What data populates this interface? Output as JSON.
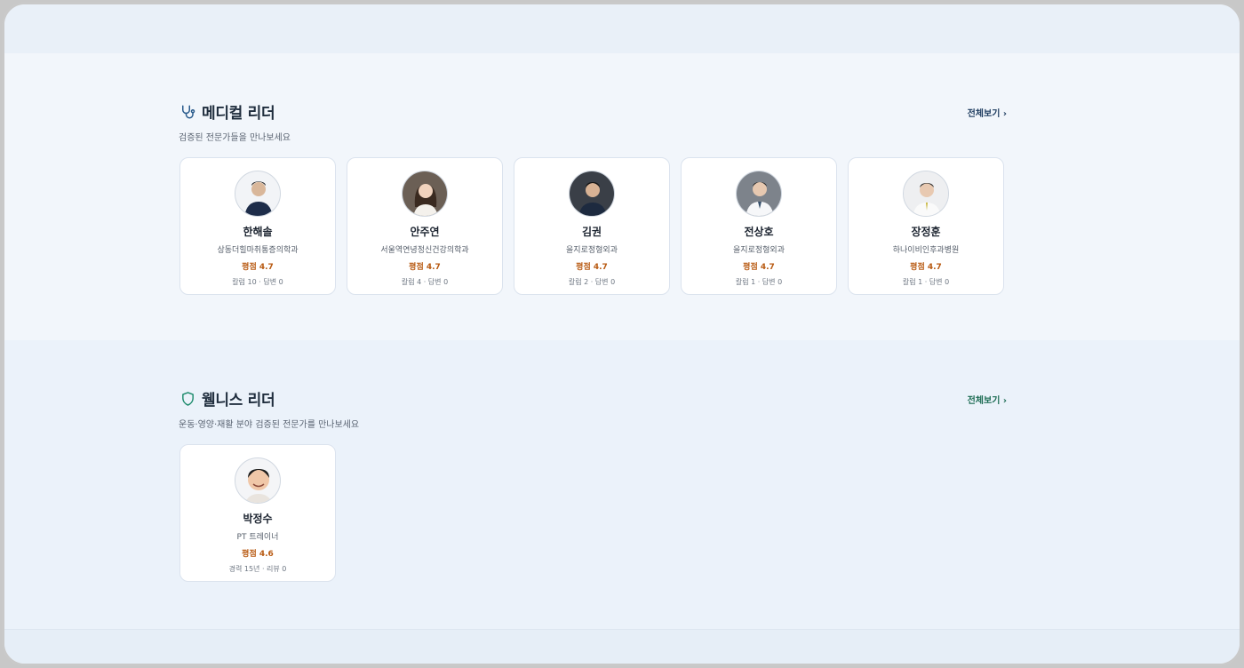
{
  "medical": {
    "title": "메디컬 리더",
    "subtitle": "검증된 전문가들을 만나보세요",
    "view_all": "전체보기 ›",
    "icon": "stethoscope-icon",
    "cards": [
      {
        "name": "한해솔",
        "dept": "상동더힐마취통증의학과",
        "rating": "평점 4.7",
        "stats": "칼럼 10 · 답변 0"
      },
      {
        "name": "안주연",
        "dept": "서울역연녕정신건강의학과",
        "rating": "평점 4.7",
        "stats": "칼럼 4 · 답변 0"
      },
      {
        "name": "김권",
        "dept": "을지로정형외과",
        "rating": "평점 4.7",
        "stats": "칼럼 2 · 답변 0"
      },
      {
        "name": "전상호",
        "dept": "을지로정형외과",
        "rating": "평점 4.7",
        "stats": "칼럼 1 · 답변 0"
      },
      {
        "name": "장정훈",
        "dept": "하나이비인후과병원",
        "rating": "평점 4.7",
        "stats": "칼럼 1 · 답변 0"
      }
    ]
  },
  "wellness": {
    "title": "웰니스 리더",
    "subtitle": "운동·영양·재활 분야 검증된 전문가를 만나보세요",
    "view_all": "전체보기 ›",
    "icon": "shield-icon",
    "cards": [
      {
        "name": "박정수",
        "dept": "PT 트레이너",
        "rating": "평점 4.6",
        "stats": "경력 15년 · 리뷰 0"
      }
    ]
  },
  "colors": {
    "rating": "#b85a12",
    "medical_icon": "#2a5b8c",
    "wellness_icon": "#1b8a6b"
  }
}
